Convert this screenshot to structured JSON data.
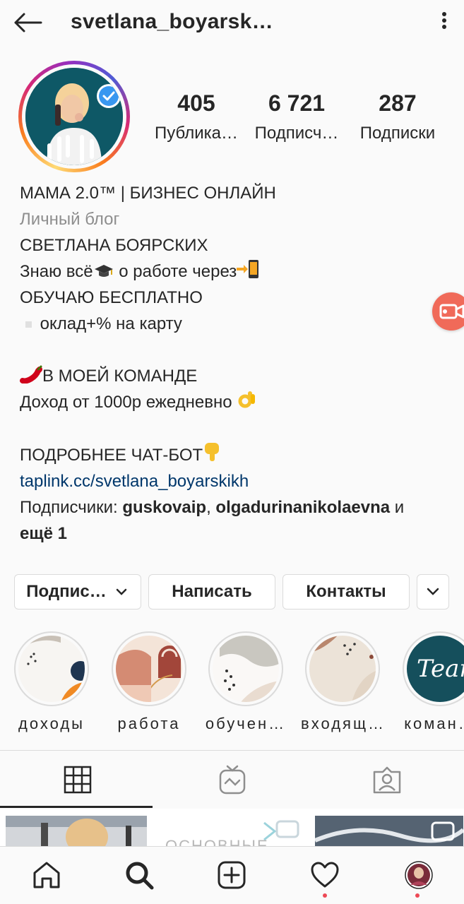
{
  "header": {
    "username": "svetlana_boyarsk…"
  },
  "stats": [
    {
      "value": "405",
      "label": "Публика…"
    },
    {
      "value": "6 721",
      "label": "Подписч…"
    },
    {
      "value": "287",
      "label": "Подписки"
    }
  ],
  "bio": {
    "name": "МАМА 2.0™ | БИЗНЕС ОНЛАЙН",
    "category": "Личный блог",
    "line1": "СВЕТЛАНА БОЯРСКИХ",
    "line2a": "Знаю всё",
    "line2b": " о работе через",
    "line3": "ОБУЧАЮ БЕСПЛАТНО",
    "line4": "оклад+% на карту",
    "line5": "В МОЕЙ КОМАНДЕ",
    "line6": "Доход  от 1000р ежедневно ",
    "line7": "ПОДРОБНЕЕ ЧАТ-БОТ",
    "link": "taplink.cc/svetlana_boyarskikh",
    "followers_prefix": "Подписчики: ",
    "follower1": "guskovaip",
    "sep": ", ",
    "follower2": "olgadurinanikolaevna",
    "and": " и",
    "more": "ещё 1"
  },
  "buttons": {
    "subscribed": "Подпис…",
    "message": "Написать",
    "contacts": "Контакты"
  },
  "highlights": [
    {
      "label": "доходы"
    },
    {
      "label": "работа"
    },
    {
      "label": "обучен…"
    },
    {
      "label": "входящ…"
    },
    {
      "label": "коман…"
    }
  ],
  "highlight_team_text": "Team",
  "grid_text": "ОСНОВНЫЕ",
  "icons": [
    "back-arrow-icon",
    "more-vertical-icon",
    "verified-icon",
    "chevron-down-icon",
    "grid-icon",
    "igtv-icon",
    "tagged-icon",
    "home-icon",
    "search-icon",
    "add-icon",
    "heart-icon"
  ],
  "colors": {
    "link": "#00376b",
    "category": "#8e8e8e",
    "verified": "#3897f0",
    "record": "#f06a59",
    "notification": "#ed4956"
  }
}
